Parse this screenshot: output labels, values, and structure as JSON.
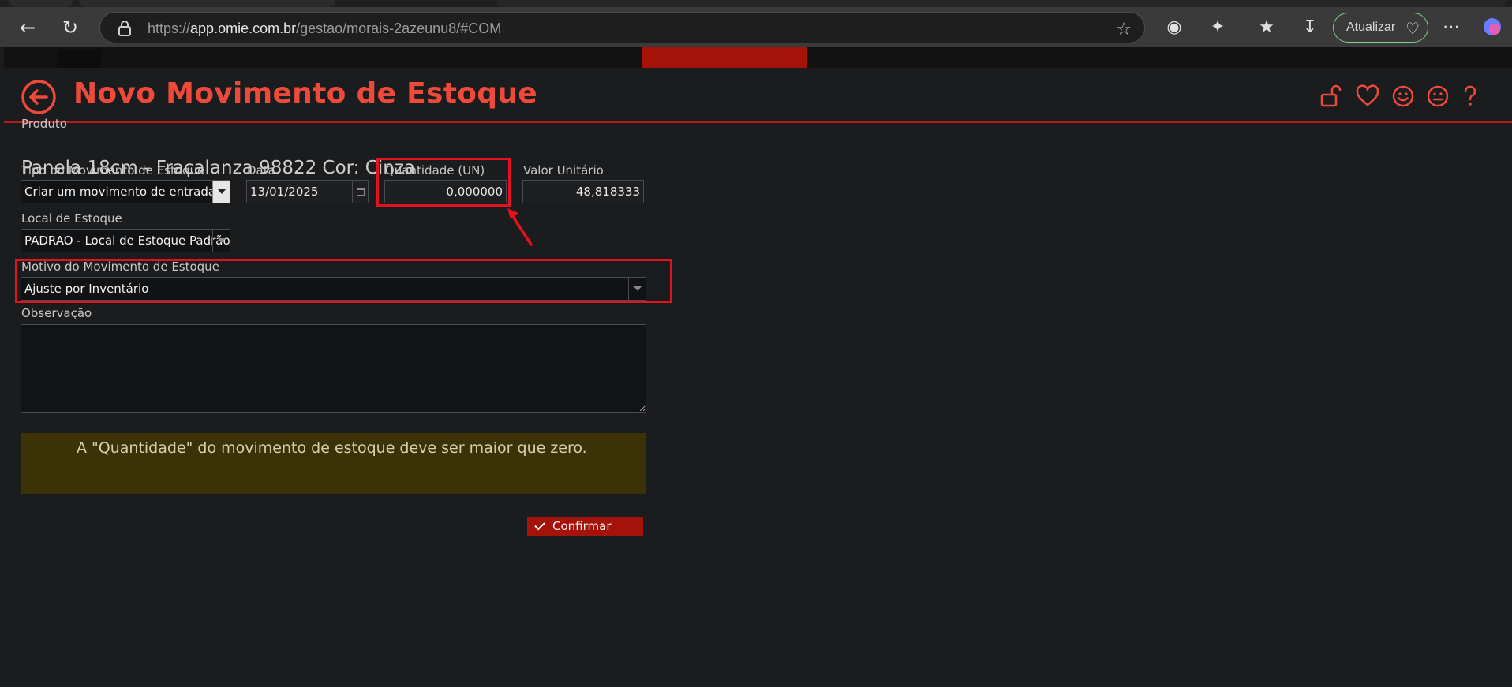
{
  "browser": {
    "url_host": "app.omie.com.br",
    "url_prefix": "https://",
    "url_path": "/gestao/morais-2azeunu8/#COM",
    "update_label": "Atualizar"
  },
  "modal": {
    "title": "Novo Movimento de Estoque",
    "product": {
      "label": "Produto",
      "value": "Panela 18cm - Fracalanza 98822 Cor: Cinza"
    },
    "movement_type": {
      "label": "Tipo do Movimento de Estoque",
      "value": "Criar um movimento de entrada"
    },
    "date": {
      "label": "Data",
      "value": "13/01/2025"
    },
    "quantity": {
      "label": "Quantidade (UN)",
      "value": "0,000000"
    },
    "unit_value": {
      "label": "Valor Unitário",
      "value": "48,818333"
    },
    "location": {
      "label": "Local de Estoque",
      "value": "PADRAO - Local de Estoque Padrão"
    },
    "reason": {
      "label": "Motivo do Movimento de Estoque",
      "value": "Ajuste por Inventário"
    },
    "observation": {
      "label": "Observação",
      "value": ""
    },
    "warning": "A \"Quantidade\" do movimento de estoque deve ser maior que zero.",
    "confirm_label": "Confirmar"
  },
  "colors": {
    "accent": "#ee4a3c",
    "highlight": "#e4121f",
    "confirm": "#a5120a",
    "warning_bg": "#3b3306"
  }
}
